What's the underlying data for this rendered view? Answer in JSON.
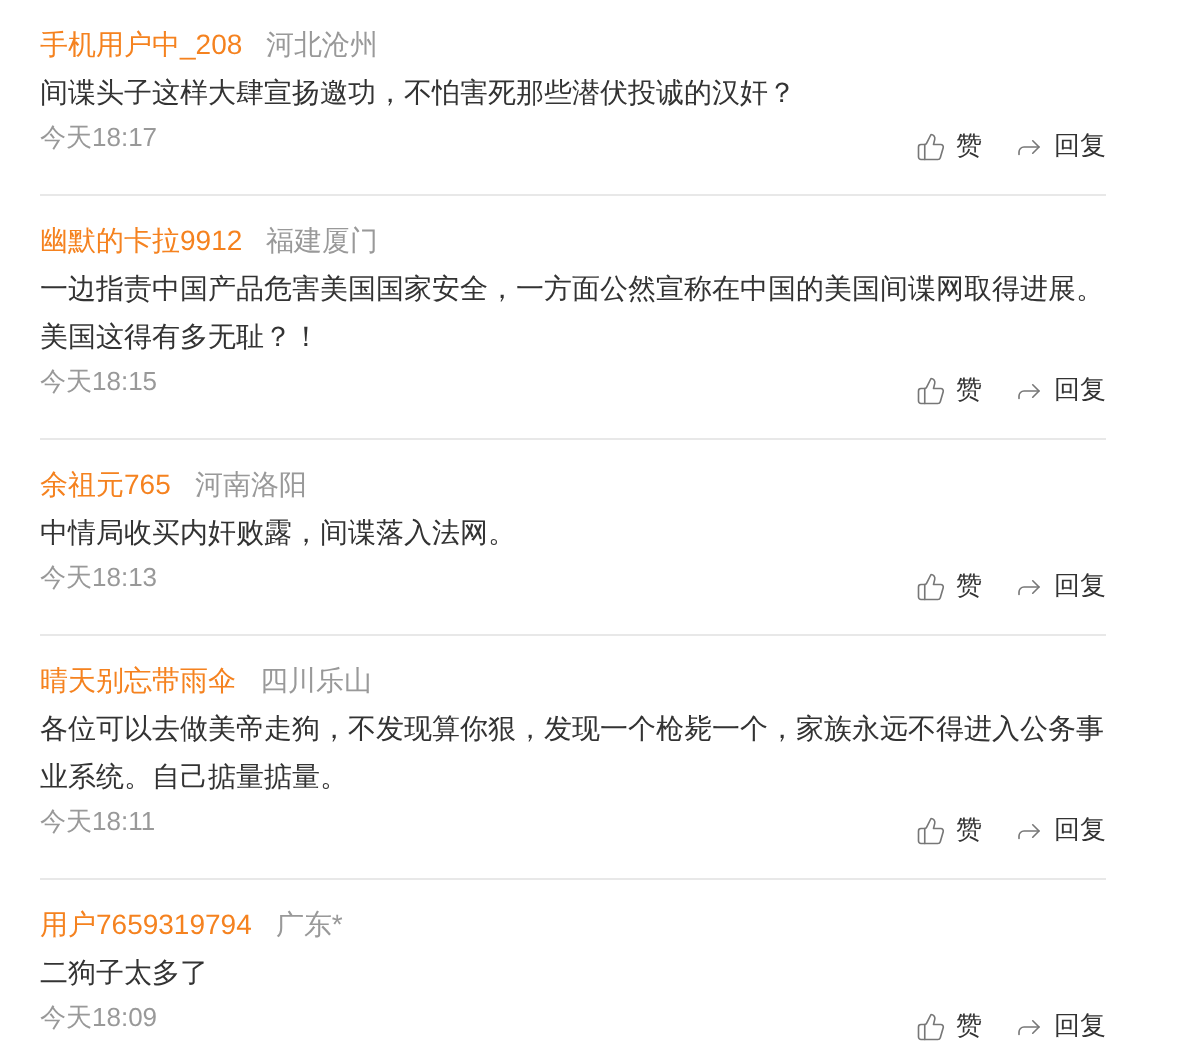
{
  "comments": [
    {
      "user": "手机用户中_208",
      "location": "河北沧州",
      "text": "间谍头子这样大肆宣扬邀功，不怕害死那些潜伏投诚的汉奸？",
      "time": "今天18:17",
      "like_label": "赞",
      "reply_label": "回复"
    },
    {
      "user": "幽默的卡拉9912",
      "location": "福建厦门",
      "text": [
        "一边指责中国产品危害美国国家安全，一方面公然宣称在中国的美国间谍网取得进展。",
        "美国这得有多无耻？！"
      ],
      "time": "今天18:15",
      "like_label": "赞",
      "reply_label": "回复"
    },
    {
      "user": "余祖元765",
      "location": "河南洛阳",
      "text": "中情局收买内奸败露，间谍落入法网。",
      "time": "今天18:13",
      "like_label": "赞",
      "reply_label": "回复"
    },
    {
      "user": "晴天别忘带雨伞",
      "location": "四川乐山",
      "text": "各位可以去做美帝走狗，不发现算你狠，发现一个枪毙一个，家族永远不得进入公务事业系统。自己掂量掂量。",
      "time": "今天18:11",
      "like_label": "赞",
      "reply_label": "回复"
    },
    {
      "user": "用户7659319794",
      "location": "广东*",
      "text": "二狗子太多了",
      "time": "今天18:09",
      "like_label": "赞",
      "reply_label": "回复"
    }
  ]
}
